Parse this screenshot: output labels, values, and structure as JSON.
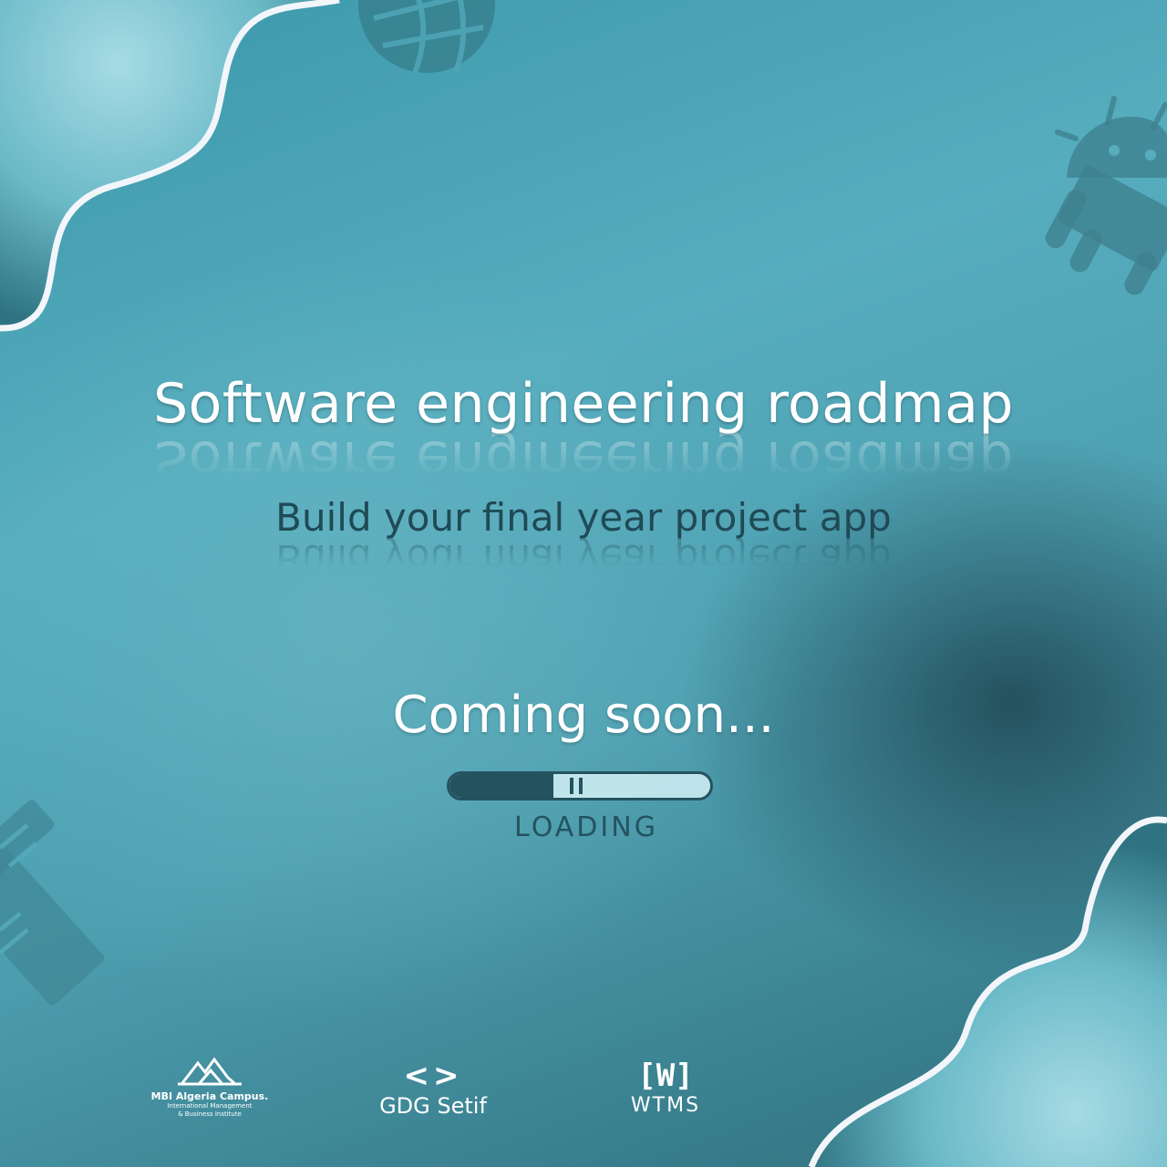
{
  "poster": {
    "headline": "Software engineering roadmap",
    "subheadline": "Build your final year project app",
    "status_text": "Coming soon...",
    "loading": {
      "label": "LOADING",
      "progress_fraction": 0.4
    },
    "colors": {
      "background": "#4ea7b8",
      "text_light": "#ffffff",
      "text_dark": "#1f4a56",
      "wave_white": "#f2f6fb"
    },
    "decorative_icons": [
      "globe-icon",
      "android-icon",
      "ruler-pencil-icon"
    ]
  },
  "partners": [
    {
      "name": "MBI Algeria Campus.",
      "subtitle_line1": "International Management",
      "subtitle_line2": "& Business Institute"
    },
    {
      "name": "GDG Setif",
      "mark": "<>"
    },
    {
      "name": "WTMS",
      "mark": "[W]"
    }
  ]
}
